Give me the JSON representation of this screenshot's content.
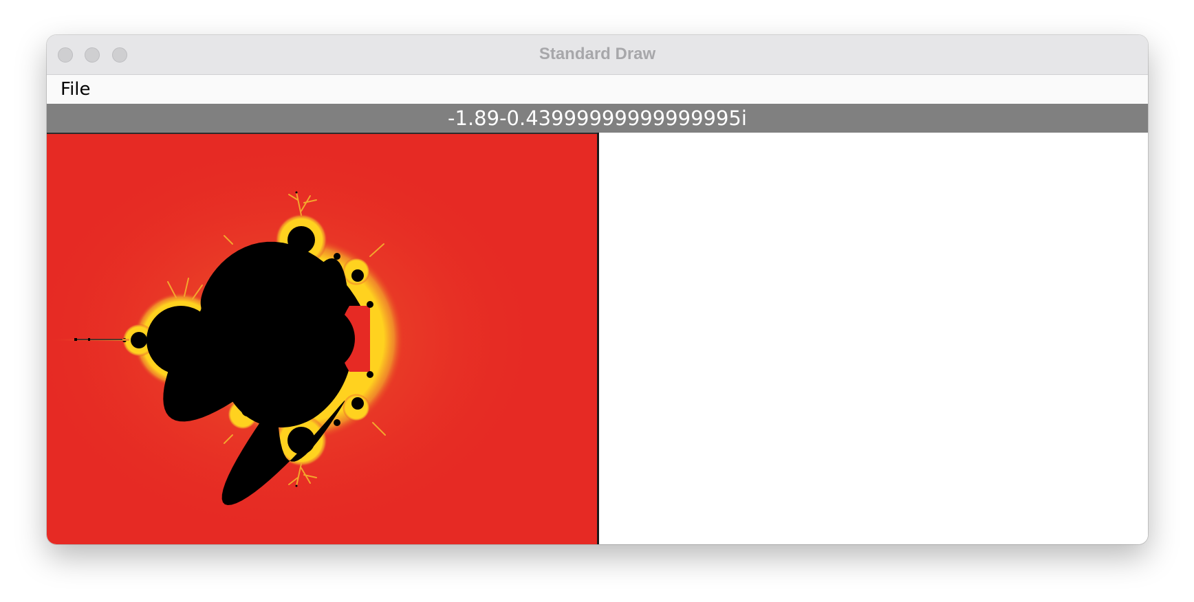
{
  "window": {
    "title": "Standard Draw"
  },
  "menu": {
    "file_label": "File"
  },
  "status": {
    "coordinate": "-1.89-0.43999999999999995i"
  },
  "colors": {
    "background": "#e62a24",
    "set": "#000000",
    "divider": "#1a1a1a",
    "coord_bar": "#808080"
  },
  "icons": {
    "close": "traffic-light-close",
    "minimize": "traffic-light-minimize",
    "zoom": "traffic-light-zoom"
  }
}
